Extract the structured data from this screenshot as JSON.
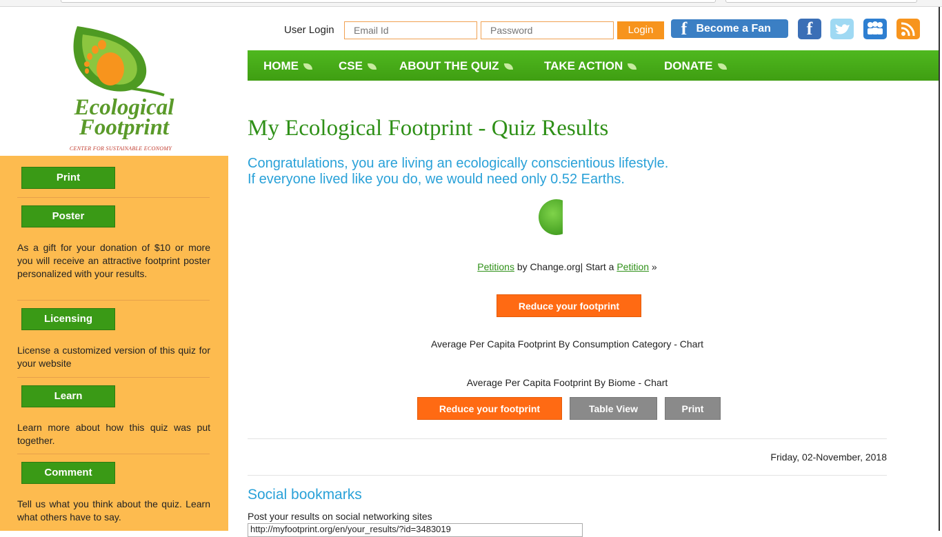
{
  "logo": {
    "line1": "Ecological",
    "line2": "Footprint",
    "sub": "CENTER FOR SUSTAINABLE ECONOMY"
  },
  "header": {
    "login_label": "User Login",
    "email_placeholder": "Email Id",
    "password_placeholder": "Password",
    "login_button": "Login",
    "fan_button": "Become a Fan"
  },
  "nav": {
    "items": [
      "HOME",
      "CSE",
      "ABOUT THE QUIZ",
      "TAKE ACTION",
      "DONATE"
    ]
  },
  "sidebar": {
    "print": "Print",
    "poster": "Poster",
    "poster_text": "As a gift for your donation of $10 or more you will receive an attractive footprint poster personalized with your results.",
    "licensing": "Licensing",
    "licensing_text": "License a customized version of this quiz for your website",
    "learn": "Learn",
    "learn_text": "Learn more about how this quiz was put together.",
    "comment": "Comment",
    "comment_text": "Tell us what you think about the quiz. Learn what others have to say."
  },
  "main": {
    "title": "My Ecological Footprint - Quiz Results",
    "congrats_line1": "Congratulations, you are living an ecologically conscientious lifestyle.",
    "congrats_line2": "If everyone lived like you do, we would need only 0.52 Earths.",
    "petitions_link": "Petitions",
    "petition_by": " by Change.org| Start a ",
    "petition_link": "Petition",
    "petition_arrow": " »",
    "reduce_button": "Reduce your footprint",
    "chart1_label": "Average Per Capita Footprint By Consumption Category - Chart",
    "chart2_label": "Average Per Capita Footprint By Biome - Chart",
    "reduce_button2": "Reduce your footprint",
    "table_view_button": "Table View",
    "print_button": "Print",
    "date": "Friday, 02-November, 2018",
    "social_heading": "Social bookmarks",
    "post_text": "Post your results on social networking sites",
    "url_value": "http://myfootprint.org/en/your_results/?id=3483019"
  },
  "colors": {
    "green": "#3f9e12",
    "orange": "#ff6a13",
    "sidebar": "#fdbb4f",
    "blue": "#29a1d8"
  }
}
